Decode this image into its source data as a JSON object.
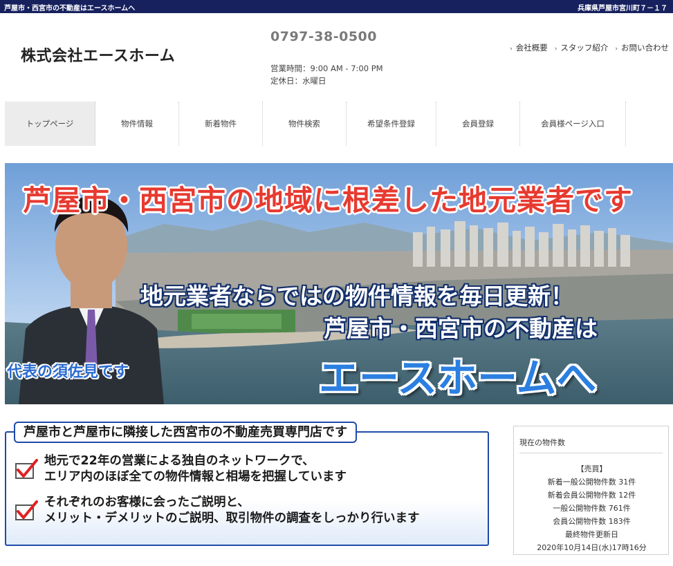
{
  "topbar": {
    "left": "芦屋市・西宮市の不動産はエースホームへ",
    "right": "兵庫県芦屋市宮川町７－１７"
  },
  "header": {
    "company": "株式会社エースホーム",
    "phone": "0797-38-0500",
    "hours": "営業時間：9:00 AM - 7:00 PM",
    "closed": "定休日：水曜日",
    "links": [
      "会社概要",
      "スタッフ紹介",
      "お問い合わせ"
    ]
  },
  "nav": [
    "トップページ",
    "物件情報",
    "新着物件",
    "物件検索",
    "希望条件登録",
    "会員登録",
    "会員様ページ入口"
  ],
  "hero": {
    "headline": "芦屋市・西宮市の地域に根差した地元業者です",
    "line1": "地元業者ならではの物件情報を毎日更新！",
    "line2": "芦屋市・西宮市の不動産は",
    "brand": "エースホームへ",
    "caption": "代表の須佐見です"
  },
  "feature": {
    "title": "芦屋市と芦屋市に隣接した西宮市の不動産売買専門店です",
    "items": [
      {
        "line1": "地元で22年の営業による独自のネットワークで、",
        "line2": "エリア内のほぼ全ての物件情報と相場を把握しています"
      },
      {
        "line1": "それぞれのお客様に会ったご説明と、",
        "line2": "メリット・デメリットのご説明、取引物件の調査をしっかり行います"
      }
    ]
  },
  "stats": {
    "title": "現在の物件数",
    "category": "【売買】",
    "new_public": "新着一般公開物件数 31件",
    "new_member": "新着会員公開物件数 12件",
    "public": "一般公開物件数 761件",
    "member": "会員公開物件数 183件",
    "updated_label": "最終物件更新日",
    "updated": "2020年10月14日(水)17時16分"
  },
  "colors": {
    "topbar": "#17215e",
    "hero_headline": "#e73a30",
    "brand_blue": "#2b7fe0",
    "frame_blue": "#1e4aa8",
    "check_red": "#e02020"
  }
}
